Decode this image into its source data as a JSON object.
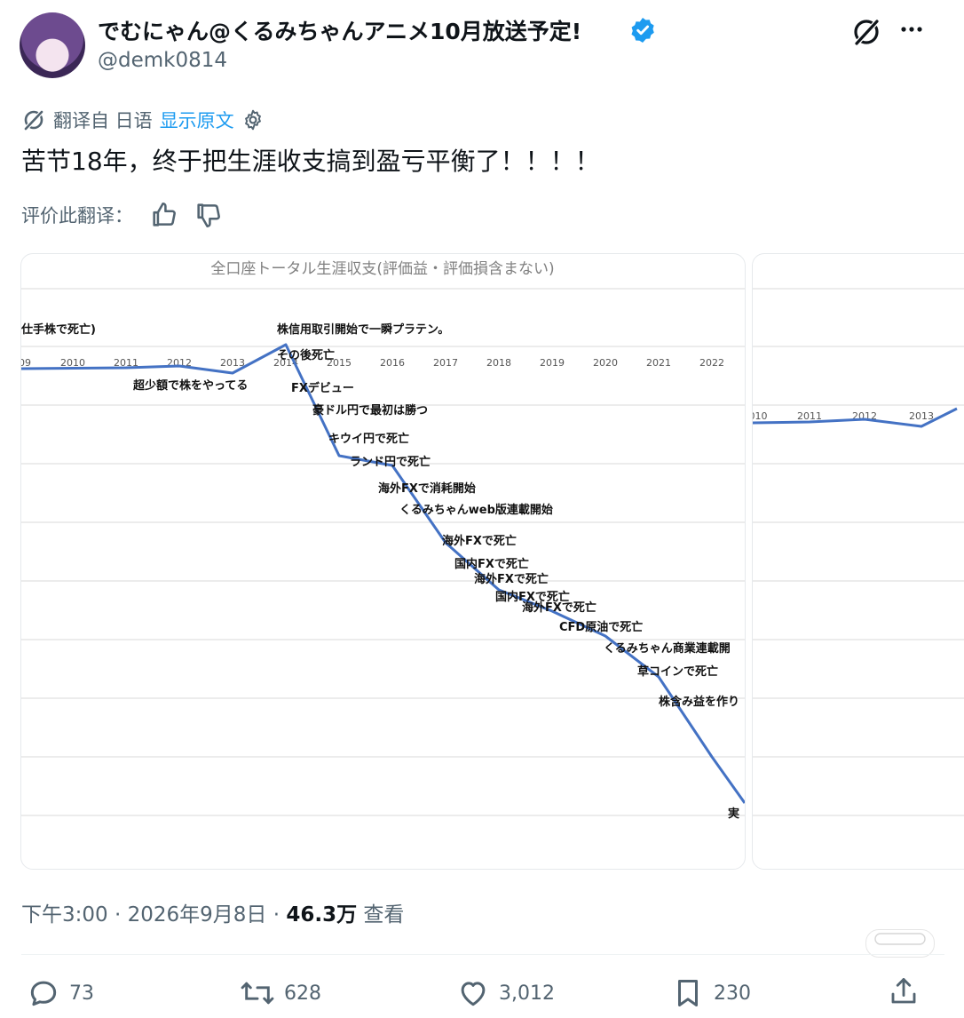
{
  "author": {
    "display_name": "でむにゃん@くるみちゃんアニメ10月放送予定!",
    "handle": "@demk0814",
    "verified": true,
    "verified_color": "#1d9bf0"
  },
  "translation": {
    "source_label": "翻译自 日语",
    "show_original": "显示原文"
  },
  "tweet_text": "苦节18年，终于把生涯收支搞到盈亏平衡了！！！！",
  "rate_translation_label": "评价此翻译：",
  "chart_main": {
    "title": "全口座トータル生涯収支(評価益・評価損含まない)",
    "x_ticks": [
      "09",
      "2010",
      "2011",
      "2012",
      "2013",
      "2014",
      "2015",
      "2016",
      "2017",
      "2018",
      "2019",
      "2020",
      "2021",
      "2022"
    ],
    "annotations": [
      "仕手株で死亡)",
      "株信用取引開始で一瞬プラテン。",
      "その後死亡",
      "超少額で株をやってる",
      "FXデビュー",
      "豪ドル円で最初は勝つ",
      "キウイ円で死亡",
      "ランド円で死亡",
      "海外FXで消耗開始",
      "くるみちゃんweb版連載開始",
      "海外FXで死亡",
      "国内FXで死亡",
      "海外FXで死亡",
      "国内FXで死亡",
      "海外FXで死亡",
      "CFD原油で死亡",
      "くるみちゃん商業連載開",
      "草コインで死亡",
      "株含み益を作り",
      "実"
    ]
  },
  "chart_secondary": {
    "x_ticks": [
      "010",
      "2011",
      "2012",
      "2013"
    ]
  },
  "meta": {
    "time": "下午3:00 · 2026年9月8日 · ",
    "views": "46.3万",
    "views_label": " 查看"
  },
  "actions": {
    "replies": "73",
    "reposts": "628",
    "likes": "3,012",
    "bookmarks": "230"
  },
  "colors": {
    "accent": "#1d9bf0",
    "line": "#4472c4",
    "muted": "#536471"
  }
}
